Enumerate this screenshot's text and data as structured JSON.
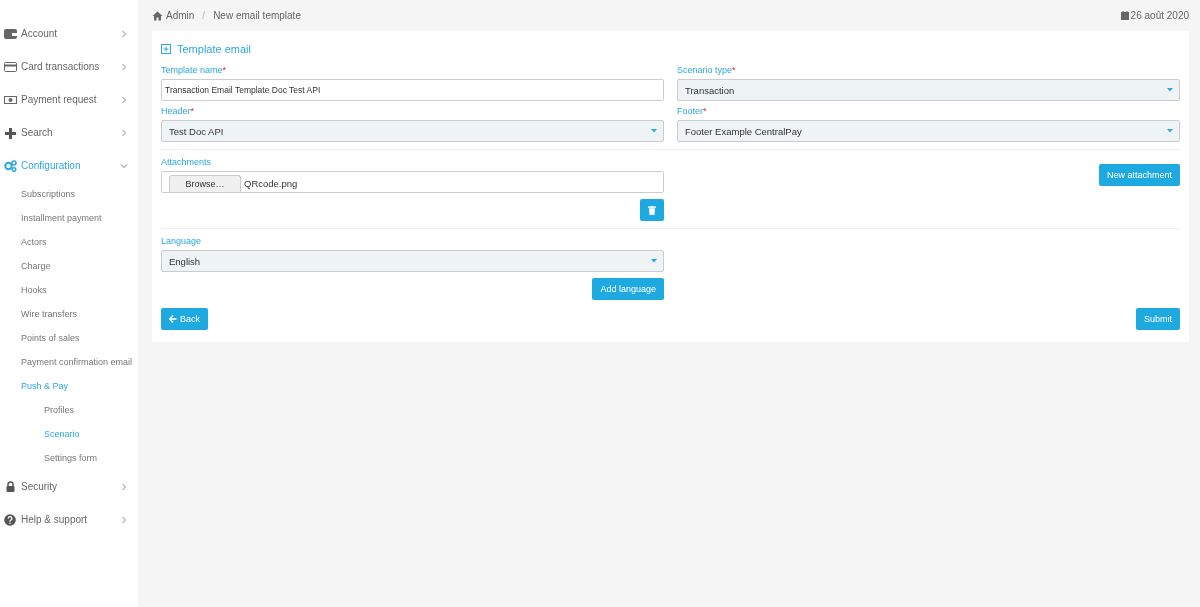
{
  "sidebar": {
    "items": [
      {
        "label": "Account",
        "selected": false,
        "expanded": false
      },
      {
        "label": "Card transactions",
        "selected": false,
        "expanded": false
      },
      {
        "label": "Payment request",
        "selected": false,
        "expanded": false
      },
      {
        "label": "Search",
        "selected": false,
        "expanded": false
      },
      {
        "label": "Configuration",
        "selected": true,
        "expanded": true,
        "children": [
          {
            "label": "Subscriptions",
            "selected": false
          },
          {
            "label": "Installment payment",
            "selected": false
          },
          {
            "label": "Actors",
            "selected": false
          },
          {
            "label": "Charge",
            "selected": false
          },
          {
            "label": "Hooks",
            "selected": false
          },
          {
            "label": "Wire transfers",
            "selected": false
          },
          {
            "label": "Points of sales",
            "selected": false
          },
          {
            "label": "Payment confirmation email",
            "selected": false
          },
          {
            "label": "Push & Pay",
            "selected": true,
            "children": [
              {
                "label": "Profiles",
                "selected": false
              },
              {
                "label": "Scenario",
                "selected": true
              },
              {
                "label": "Settings form",
                "selected": false
              }
            ]
          }
        ]
      },
      {
        "label": "Security",
        "selected": false,
        "expanded": false
      },
      {
        "label": "Help & support",
        "selected": false,
        "expanded": false
      }
    ]
  },
  "breadcrumb": [
    {
      "label": "Admin"
    },
    {
      "label": "/"
    },
    {
      "label": "New email template"
    }
  ],
  "date": "26 août 2020",
  "form": {
    "title": "Template email",
    "fields": [
      {
        "kind": "text",
        "label": "Template name",
        "required_mark": "*",
        "value": "Transaction Email Template Doc Test API"
      },
      {
        "kind": "select",
        "label": "Scenario type",
        "required_mark": "*",
        "value": "Transaction"
      },
      {
        "kind": "select",
        "label": "Header",
        "required_mark": "*",
        "value": "Test Doc API"
      },
      {
        "kind": "select",
        "label": "Footer",
        "required_mark": "*",
        "value": "Footer Example CentralPay"
      }
    ],
    "attachments": {
      "label": "Attachments",
      "browse_button": "Browse…",
      "file_name": "QRcode.png",
      "new_button": "New attachment"
    },
    "language": {
      "label": "Language",
      "value": "English",
      "add_button": "Add language"
    },
    "back_button": "Back",
    "submit_button": "Submit"
  }
}
